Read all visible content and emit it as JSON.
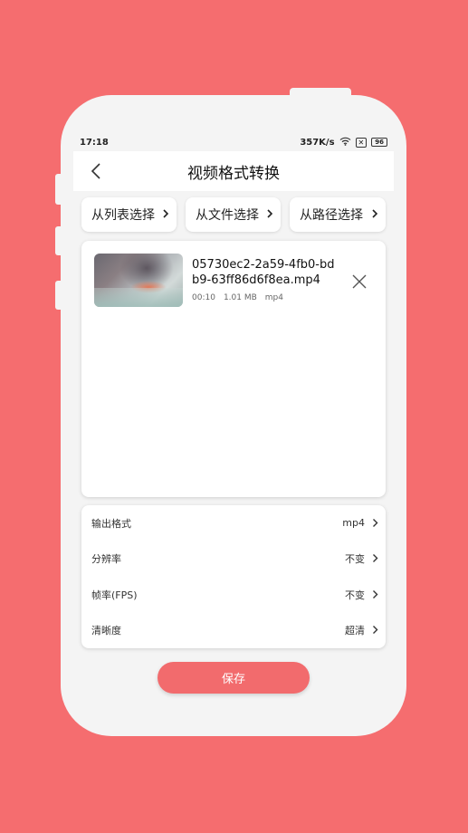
{
  "status_bar": {
    "time": "17:18",
    "speed": "357K/s",
    "sim": "✕",
    "battery": "96"
  },
  "header": {
    "title": "视频格式转换"
  },
  "sources": [
    {
      "label": "从列表选择"
    },
    {
      "label": "从文件选择"
    },
    {
      "label": "从路径选择"
    }
  ],
  "video": {
    "filename": "05730ec2-2a59-4fb0-bdb9-63ff86d6f8ea.mp4",
    "duration": "00:10",
    "size": "1.01 MB",
    "format": "mp4"
  },
  "settings": [
    {
      "label": "输出格式",
      "value": "mp4"
    },
    {
      "label": "分辨率",
      "value": "不变"
    },
    {
      "label": "帧率(FPS)",
      "value": "不变"
    },
    {
      "label": "清晰度",
      "value": "超清"
    }
  ],
  "save_label": "保存",
  "colors": {
    "background": "#f56d6f",
    "accent": "#f26b6d",
    "surface": "#ffffff"
  }
}
